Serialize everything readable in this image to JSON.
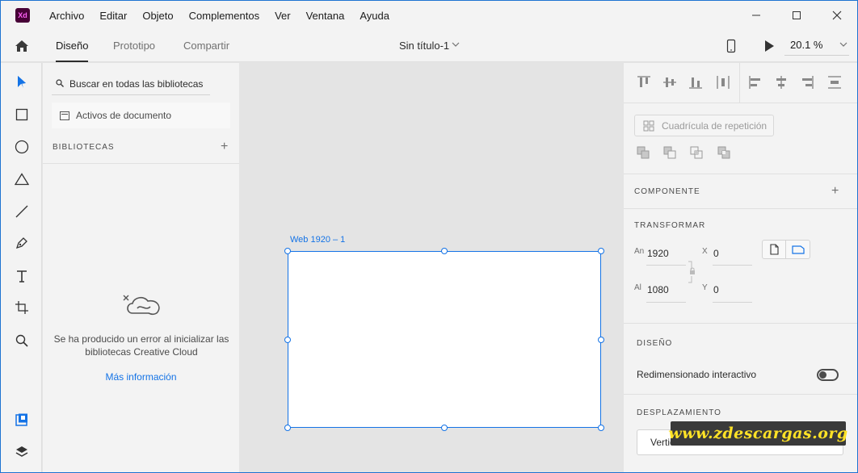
{
  "app": {
    "logo": "Xd"
  },
  "menu": [
    "Archivo",
    "Editar",
    "Objeto",
    "Complementos",
    "Ver",
    "Ventana",
    "Ayuda"
  ],
  "modes": {
    "design": "Diseño",
    "prototype": "Prototipo",
    "share": "Compartir"
  },
  "document": {
    "title": "Sin título-1"
  },
  "zoom": {
    "value": "20.1 %"
  },
  "libraries": {
    "search_placeholder": "Buscar en todas las bibliotecas",
    "document_assets": "Activos de documento",
    "header": "BIBLIOTECAS",
    "error": "Se ha producido un error al inicializar las bibliotecas Creative Cloud",
    "link": "Más información"
  },
  "canvas": {
    "artboard_name": "Web 1920 – 1"
  },
  "properties": {
    "repeat_grid": "Cuadrícula de repetición",
    "component": "COMPONENTE",
    "transform": "TRANSFORMAR",
    "width_label": "An",
    "width": "1920",
    "height_label": "Al",
    "height": "1080",
    "x_label": "X",
    "x": "0",
    "y_label": "Y",
    "y": "0",
    "design": "DISEÑO",
    "responsive_resize": "Redimensionado interactivo",
    "scroll": "DESPLAZAMIENTO",
    "scroll_value": "Vertical"
  },
  "watermark": "www.zdescargas.org",
  "colors": {
    "accent": "#1473e6",
    "panel": "#f3f3f3",
    "canvas": "#e4e4e4",
    "brand": "#470137"
  }
}
